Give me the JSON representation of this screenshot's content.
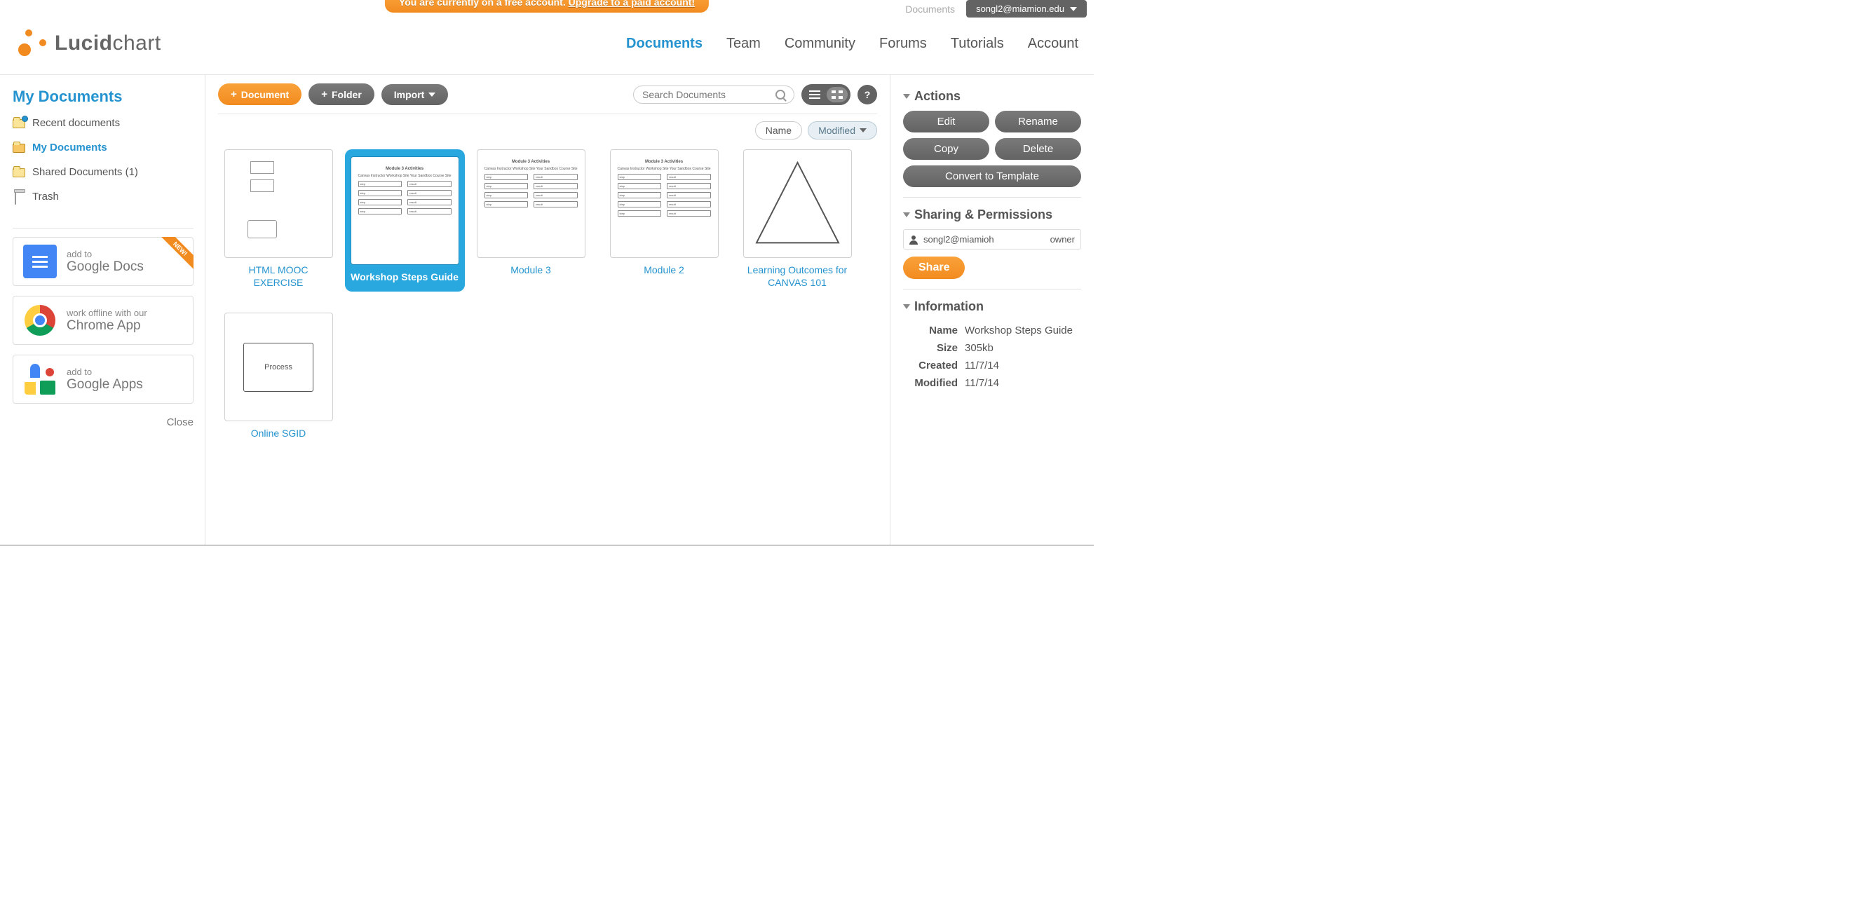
{
  "banner": {
    "prefix": "You are currently on a free account. ",
    "link": "Upgrade to a paid account!"
  },
  "top_right": {
    "documents_link": "Documents",
    "user_email": "songl2@miamion.edu"
  },
  "logo": {
    "bold": "Lucid",
    "light": "chart"
  },
  "nav": {
    "items": [
      {
        "label": "Documents",
        "active": true
      },
      {
        "label": "Team"
      },
      {
        "label": "Community"
      },
      {
        "label": "Forums"
      },
      {
        "label": "Tutorials"
      },
      {
        "label": "Account"
      }
    ]
  },
  "sidebar": {
    "title": "My Documents",
    "folders": [
      {
        "label": "Recent documents",
        "icon": "recent"
      },
      {
        "label": "My Documents",
        "icon": "folder",
        "active": true
      },
      {
        "label": "Shared Documents (1)",
        "icon": "folder"
      },
      {
        "label": "Trash",
        "icon": "trash"
      }
    ],
    "promos": [
      {
        "small": "add to",
        "big": "Google Docs",
        "kind": "gdocs",
        "new": true
      },
      {
        "small": "work offline with our",
        "big": "Chrome App",
        "kind": "chrome"
      },
      {
        "small": "add to",
        "big": "Google Apps",
        "kind": "gapps"
      }
    ],
    "close": "Close"
  },
  "toolbar": {
    "document_btn": "Document",
    "folder_btn": "Folder",
    "import_btn": "Import",
    "search_placeholder": "Search Documents",
    "help": "?"
  },
  "sort": {
    "name": "Name",
    "modified": "Modified"
  },
  "documents": [
    {
      "label": "HTML MOOC EXERCISE",
      "thumb": "boxes"
    },
    {
      "label": "Workshop Steps Guide",
      "thumb": "flow",
      "selected": true
    },
    {
      "label": "Module 3",
      "thumb": "flow"
    },
    {
      "label": "Module 2",
      "thumb": "flow"
    },
    {
      "label": "Learning Outcomes for CANVAS 101",
      "thumb": "triangle"
    },
    {
      "label": "Online SGID",
      "thumb": "process"
    }
  ],
  "thumb_text": {
    "flow_title": "Module 3 Activities",
    "flow_left": "Canvas Instructor Workshop Site",
    "flow_right": "Your Sandbox Course Site",
    "process": "Process"
  },
  "right": {
    "actions_title": "Actions",
    "edit": "Edit",
    "rename": "Rename",
    "copy": "Copy",
    "delete": "Delete",
    "convert": "Convert to Template",
    "sharing_title": "Sharing & Permissions",
    "perm_user": "songl2@miamioh",
    "perm_role": "owner",
    "share": "Share",
    "info_title": "Information",
    "info": {
      "name_k": "Name",
      "name_v": "Workshop Steps Guide",
      "size_k": "Size",
      "size_v": "305kb",
      "created_k": "Created",
      "created_v": "11/7/14",
      "modified_k": "Modified",
      "modified_v": "11/7/14"
    }
  }
}
